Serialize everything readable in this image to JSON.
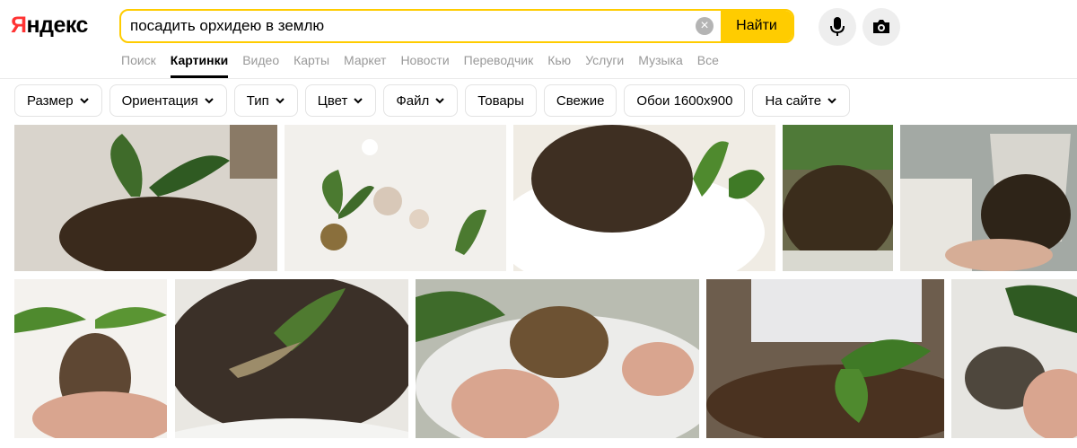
{
  "logo": {
    "first": "Я",
    "rest": "ндекс"
  },
  "search": {
    "query": "посадить орхидею в землю",
    "clear_symbol": "×",
    "button_label": "Найти"
  },
  "voice": {
    "icon": "microphone-icon"
  },
  "camera": {
    "icon": "camera-icon"
  },
  "tabs": [
    {
      "label": "Поиск",
      "active": false
    },
    {
      "label": "Картинки",
      "active": true
    },
    {
      "label": "Видео",
      "active": false
    },
    {
      "label": "Карты",
      "active": false
    },
    {
      "label": "Маркет",
      "active": false
    },
    {
      "label": "Новости",
      "active": false
    },
    {
      "label": "Переводчик",
      "active": false
    },
    {
      "label": "Кью",
      "active": false
    },
    {
      "label": "Услуги",
      "active": false
    },
    {
      "label": "Музыка",
      "active": false
    },
    {
      "label": "Все",
      "active": false
    }
  ],
  "filters": [
    {
      "label": "Размер",
      "dropdown": true
    },
    {
      "label": "Ориентация",
      "dropdown": true
    },
    {
      "label": "Тип",
      "dropdown": true
    },
    {
      "label": "Цвет",
      "dropdown": true
    },
    {
      "label": "Файл",
      "dropdown": true
    },
    {
      "label": "Товары",
      "dropdown": false
    },
    {
      "label": "Свежие",
      "dropdown": false
    },
    {
      "label": "Обои 1600x900",
      "dropdown": false
    },
    {
      "label": "На сайте",
      "dropdown": true
    }
  ],
  "colors": {
    "accent": "#ffcc00",
    "logo_red": "#ff3333",
    "tab_inactive": "#999999",
    "chip_border": "#e3e3e3",
    "image_bg": [
      "#8a7a66",
      "#f2f0ec",
      "#3e2f22",
      "#6b6a4c",
      "#a3a9a4",
      "#5e4733",
      "#3b3028",
      "#b9bcb1",
      "#6d5d4d",
      "#4e473d"
    ]
  }
}
